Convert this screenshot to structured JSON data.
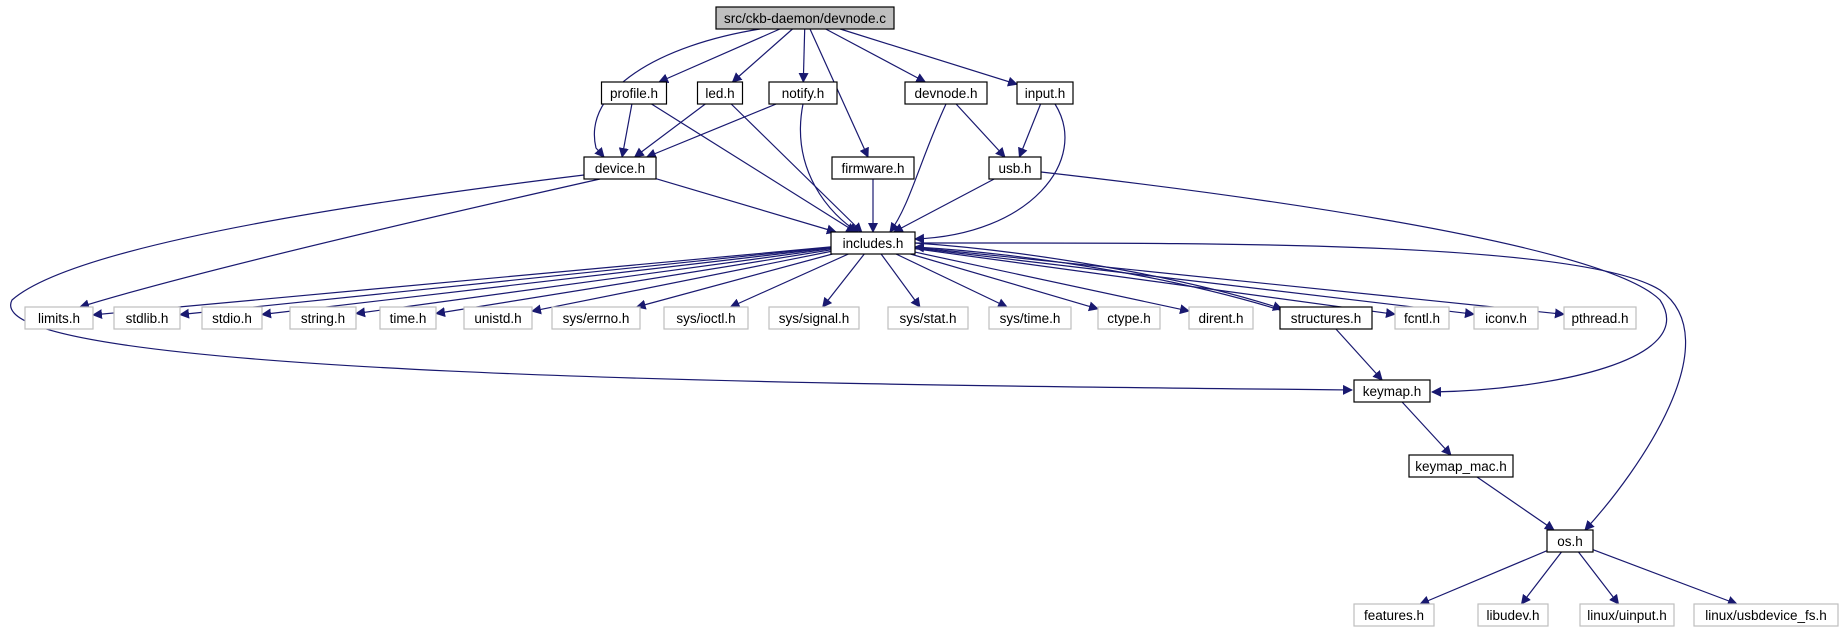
{
  "diagram": {
    "kind": "include dependency graph",
    "root": "src/ckb-daemon/devnode.c",
    "colors": {
      "edge": "#191970",
      "root_fill": "#bfbfbf",
      "node_border": "#000000",
      "external_border": "#bfbfbf",
      "text": "#000000"
    },
    "nodes": [
      {
        "id": "root",
        "label": "src/ckb-daemon/devnode.c",
        "style": "root"
      },
      {
        "id": "profile",
        "label": "profile.h",
        "style": "internal"
      },
      {
        "id": "led",
        "label": "led.h",
        "style": "internal"
      },
      {
        "id": "notify",
        "label": "notify.h",
        "style": "internal"
      },
      {
        "id": "devnode",
        "label": "devnode.h",
        "style": "internal"
      },
      {
        "id": "input",
        "label": "input.h",
        "style": "internal"
      },
      {
        "id": "device",
        "label": "device.h",
        "style": "internal"
      },
      {
        "id": "firmware",
        "label": "firmware.h",
        "style": "internal"
      },
      {
        "id": "usb",
        "label": "usb.h",
        "style": "internal"
      },
      {
        "id": "includes",
        "label": "includes.h",
        "style": "internal"
      },
      {
        "id": "limits",
        "label": "limits.h",
        "style": "external"
      },
      {
        "id": "stdlib",
        "label": "stdlib.h",
        "style": "external"
      },
      {
        "id": "stdio",
        "label": "stdio.h",
        "style": "external"
      },
      {
        "id": "string",
        "label": "string.h",
        "style": "external"
      },
      {
        "id": "time",
        "label": "time.h",
        "style": "external"
      },
      {
        "id": "unistd",
        "label": "unistd.h",
        "style": "external"
      },
      {
        "id": "errno",
        "label": "sys/errno.h",
        "style": "external"
      },
      {
        "id": "ioctl",
        "label": "sys/ioctl.h",
        "style": "external"
      },
      {
        "id": "signal",
        "label": "sys/signal.h",
        "style": "external"
      },
      {
        "id": "stat",
        "label": "sys/stat.h",
        "style": "external"
      },
      {
        "id": "systime",
        "label": "sys/time.h",
        "style": "external"
      },
      {
        "id": "ctype",
        "label": "ctype.h",
        "style": "external"
      },
      {
        "id": "dirent",
        "label": "dirent.h",
        "style": "external"
      },
      {
        "id": "structures",
        "label": "structures.h",
        "style": "internal"
      },
      {
        "id": "fcntl",
        "label": "fcntl.h",
        "style": "external"
      },
      {
        "id": "iconv",
        "label": "iconv.h",
        "style": "external"
      },
      {
        "id": "pthread",
        "label": "pthread.h",
        "style": "external"
      },
      {
        "id": "keymap",
        "label": "keymap.h",
        "style": "internal"
      },
      {
        "id": "keymap_mac",
        "label": "keymap_mac.h",
        "style": "internal"
      },
      {
        "id": "os",
        "label": "os.h",
        "style": "internal"
      },
      {
        "id": "features",
        "label": "features.h",
        "style": "external"
      },
      {
        "id": "libudev",
        "label": "libudev.h",
        "style": "external"
      },
      {
        "id": "uinput",
        "label": "linux/uinput.h",
        "style": "external"
      },
      {
        "id": "usbdevice_fs",
        "label": "linux/usbdevice_fs.h",
        "style": "external"
      }
    ],
    "edges": [
      [
        "root",
        "device"
      ],
      [
        "root",
        "profile"
      ],
      [
        "root",
        "led"
      ],
      [
        "root",
        "notify"
      ],
      [
        "root",
        "firmware"
      ],
      [
        "root",
        "devnode"
      ],
      [
        "root",
        "input"
      ],
      [
        "profile",
        "device"
      ],
      [
        "profile",
        "includes"
      ],
      [
        "led",
        "device"
      ],
      [
        "led",
        "includes"
      ],
      [
        "notify",
        "device"
      ],
      [
        "notify",
        "includes"
      ],
      [
        "devnode",
        "usb"
      ],
      [
        "devnode",
        "includes"
      ],
      [
        "input",
        "usb"
      ],
      [
        "input",
        "includes"
      ],
      [
        "firmware",
        "includes"
      ],
      [
        "device",
        "includes"
      ],
      [
        "device",
        "limits"
      ],
      [
        "device",
        "keymap"
      ],
      [
        "usb",
        "includes"
      ],
      [
        "usb",
        "keymap"
      ],
      [
        "includes",
        "limits"
      ],
      [
        "includes",
        "stdlib"
      ],
      [
        "includes",
        "stdio"
      ],
      [
        "includes",
        "string"
      ],
      [
        "includes",
        "time"
      ],
      [
        "includes",
        "unistd"
      ],
      [
        "includes",
        "errno"
      ],
      [
        "includes",
        "ioctl"
      ],
      [
        "includes",
        "signal"
      ],
      [
        "includes",
        "stat"
      ],
      [
        "includes",
        "systime"
      ],
      [
        "includes",
        "ctype"
      ],
      [
        "includes",
        "dirent"
      ],
      [
        "includes",
        "structures"
      ],
      [
        "includes",
        "fcntl"
      ],
      [
        "includes",
        "iconv"
      ],
      [
        "includes",
        "pthread"
      ],
      [
        "includes",
        "os"
      ],
      [
        "structures",
        "includes"
      ],
      [
        "structures",
        "keymap"
      ],
      [
        "keymap",
        "keymap_mac"
      ],
      [
        "keymap_mac",
        "os"
      ],
      [
        "os",
        "features"
      ],
      [
        "os",
        "libudev"
      ],
      [
        "os",
        "uinput"
      ],
      [
        "os",
        "usbdevice_fs"
      ]
    ]
  }
}
